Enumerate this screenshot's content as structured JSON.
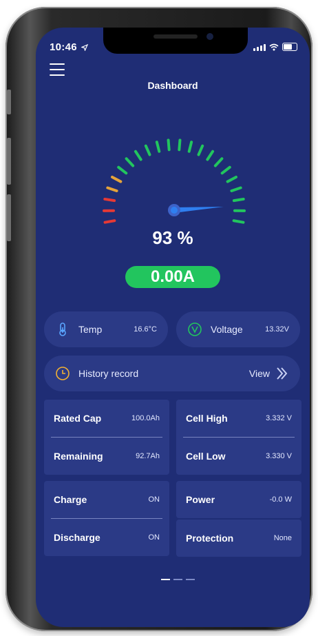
{
  "status": {
    "time": "10:46"
  },
  "header": {
    "title": "Dashboard"
  },
  "gauge": {
    "percent_text": "93 %",
    "percent_value": 93,
    "current": "0.00A"
  },
  "sensors": {
    "temp": {
      "label": "Temp",
      "value": "16.6°C"
    },
    "voltage": {
      "label": "Voltage",
      "value": "13.32V"
    }
  },
  "history": {
    "label": "History record",
    "action": "View"
  },
  "cards": {
    "rated_cap": {
      "label": "Rated Cap",
      "value": "100.0Ah"
    },
    "remaining": {
      "label": "Remaining",
      "value": "92.7Ah"
    },
    "cell_high": {
      "label": "Cell High",
      "value": "3.332 V"
    },
    "cell_low": {
      "label": "Cell Low",
      "value": "3.330 V"
    },
    "charge": {
      "label": "Charge",
      "value": "ON"
    },
    "discharge": {
      "label": "Discharge",
      "value": "ON"
    },
    "power": {
      "label": "Power",
      "value": "-0.0 W"
    },
    "protection": {
      "label": "Protection",
      "value": "None"
    }
  },
  "colors": {
    "background": "#1f2d75",
    "card": "#2b3a86",
    "accent_green": "#22c55e",
    "warning_orange": "#e5a33a",
    "danger_red": "#e53935",
    "needle_blue": "#2f7ff0"
  },
  "icons": {
    "menu": "hamburger-icon",
    "temp": "thermometer-icon",
    "voltage": "voltage-icon",
    "history": "clock-icon",
    "view": "double-chevron-right-icon"
  },
  "pager": {
    "pages": 3,
    "active": 1
  }
}
